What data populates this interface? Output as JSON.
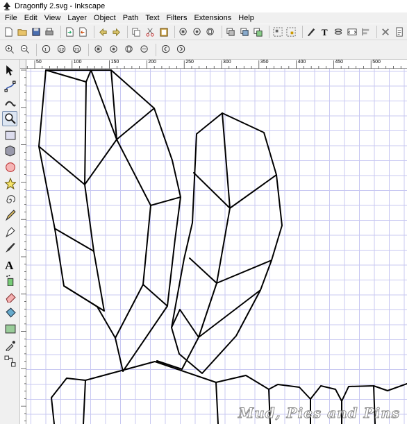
{
  "window": {
    "title": "Dragonfly 2.svg - Inkscape",
    "app_icon": "inkscape-icon"
  },
  "menu": [
    {
      "label": "File"
    },
    {
      "label": "Edit"
    },
    {
      "label": "View"
    },
    {
      "label": "Layer"
    },
    {
      "label": "Object"
    },
    {
      "label": "Path"
    },
    {
      "label": "Text"
    },
    {
      "label": "Filters"
    },
    {
      "label": "Extensions"
    },
    {
      "label": "Help"
    }
  ],
  "commands_bar": [
    "new-document-icon",
    "open-icon",
    "save-icon",
    "print-icon",
    "|",
    "import-icon",
    "export-icon",
    "|",
    "undo-icon",
    "redo-icon",
    "|",
    "copy-icon",
    "cut-icon",
    "paste-icon",
    "|",
    "zoom-selection-icon",
    "zoom-drawing-icon",
    "zoom-page-icon",
    "|",
    "duplicate-icon",
    "clone-icon",
    "unlink-clone-icon",
    "|",
    "group-icon",
    "ungroup-icon",
    "|",
    "fill-stroke-icon",
    "text-font-icon",
    "layers-icon",
    "xml-editor-icon",
    "align-icon",
    "|",
    "preferences-icon",
    "document-properties-icon"
  ],
  "zoom_bar": [
    "zoom-in-icon",
    "zoom-out-icon",
    "|",
    "zoom-1-1-icon",
    "zoom-1-2-icon",
    "zoom-2-1-icon",
    "|",
    "zoom-selection-icon",
    "zoom-drawing-icon",
    "zoom-page-icon",
    "zoom-page-width-icon",
    "|",
    "zoom-previous-icon",
    "zoom-next-icon"
  ],
  "tools": [
    {
      "name": "selector-tool",
      "icon": "arrow-icon"
    },
    {
      "name": "node-tool",
      "icon": "node-icon"
    },
    {
      "name": "tweak-tool",
      "icon": "tweak-icon"
    },
    {
      "name": "zoom-tool",
      "icon": "magnifier-icon",
      "active": true
    },
    {
      "name": "rectangle-tool",
      "icon": "rectangle-icon"
    },
    {
      "name": "3d-box-tool",
      "icon": "box3d-icon"
    },
    {
      "name": "ellipse-tool",
      "icon": "circle-icon"
    },
    {
      "name": "star-tool",
      "icon": "star-icon"
    },
    {
      "name": "spiral-tool",
      "icon": "spiral-icon"
    },
    {
      "name": "pencil-tool",
      "icon": "pencil-icon"
    },
    {
      "name": "pen-tool",
      "icon": "pen-icon"
    },
    {
      "name": "calligraphy-tool",
      "icon": "calligraphy-icon"
    },
    {
      "name": "text-tool",
      "icon": "text-icon"
    },
    {
      "name": "spray-tool",
      "icon": "spray-icon"
    },
    {
      "name": "eraser-tool",
      "icon": "eraser-icon"
    },
    {
      "name": "paint-bucket-tool",
      "icon": "bucket-icon"
    },
    {
      "name": "gradient-tool",
      "icon": "gradient-icon"
    },
    {
      "name": "dropper-tool",
      "icon": "dropper-icon"
    },
    {
      "name": "connector-tool",
      "icon": "connector-icon"
    }
  ],
  "ruler": {
    "labels": [
      "50",
      "100",
      "150",
      "200",
      "250",
      "300",
      "350",
      "400",
      "450",
      "500"
    ]
  },
  "watermark": "Mud, Pies and Pins",
  "colors": {
    "chrome": "#f0f0f0",
    "grid": "#c8c8f2",
    "stroke": "#000000",
    "active_tool": "#dde6f2"
  }
}
